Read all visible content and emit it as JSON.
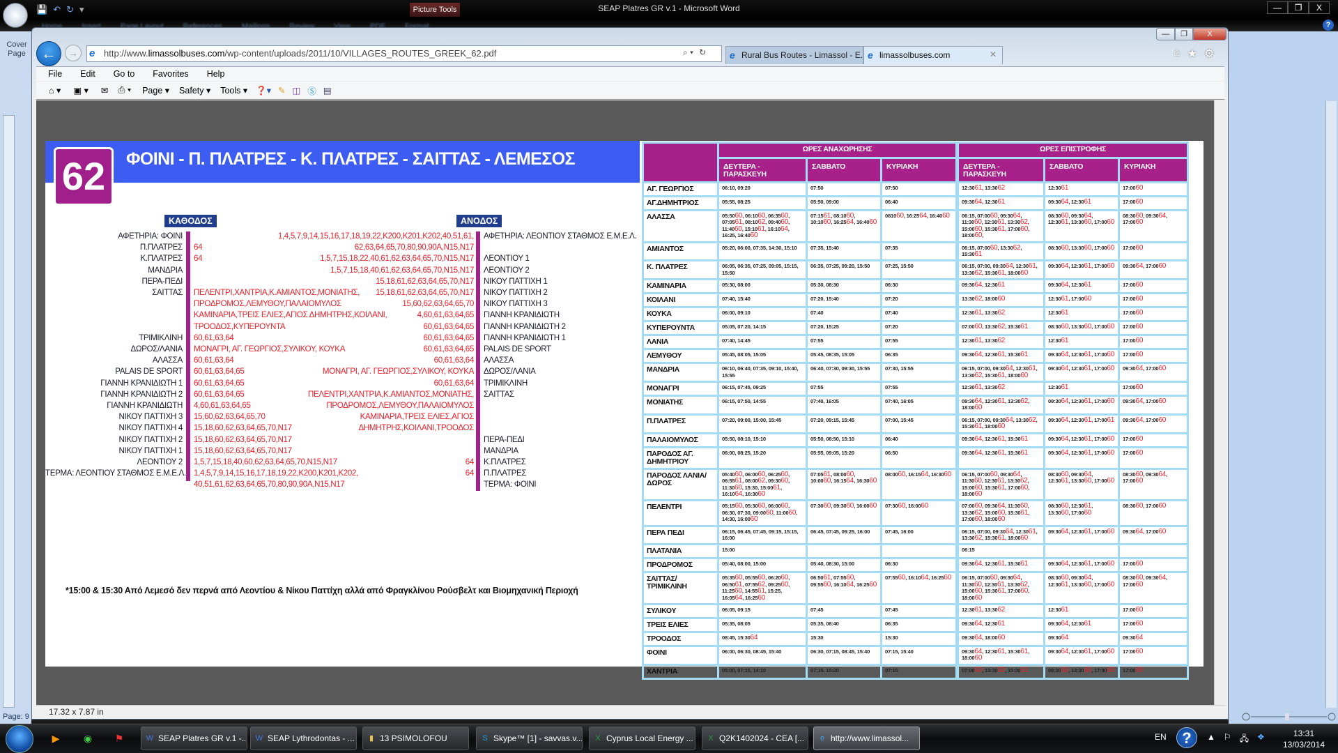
{
  "word": {
    "title": "SEAP Platres GR v.1 - Microsoft Word",
    "picture_tools": "Picture Tools",
    "tabs": [
      "Home",
      "Insert",
      "Page Layout",
      "References",
      "Mailings",
      "Review",
      "View",
      "PDF",
      "Format"
    ],
    "cover_page": "Cover Page",
    "page_status": "Page: 9",
    "controls": [
      "—",
      "❐",
      "X"
    ]
  },
  "ie": {
    "url_prefix": "http://www.",
    "url_domain": "limassolbuses.com",
    "url_path": "/wp-content/uploads/2011/10/VILLAGES_ROUTES_GREEK_62.pdf",
    "tabs": [
      {
        "label": "Rural Bus Routes - Limassol - E...",
        "active": false
      },
      {
        "label": "limassolbuses.com",
        "active": true
      }
    ],
    "menu": [
      "File",
      "Edit",
      "Go to",
      "Favorites",
      "Help"
    ],
    "command_bar": {
      "page": "Page ▾",
      "safety": "Safety ▾",
      "tools": "Tools ▾"
    },
    "status_text": "17.32 x 7.87 in",
    "controls": [
      "—",
      "❐",
      "X"
    ]
  },
  "pdf": {
    "route_number": "62",
    "route_title": "ΦΟΙΝΙ - Π. ΠΛΑΤΡΕΣ - Κ. ΠΛΑΤΡΕΣ - ΣΑΙΤΤΑΣ - ΛΕΜΕΣΟΣ",
    "kathodos_label": "ΚΑΘΟΔΟΣ",
    "anodos_label": "ΑΝΟΔΟΣ",
    "route_lines": [
      [
        "ΑΦΕΤΗΡΙΑ: ΦΟΙΝΙ",
        "",
        "1,4,5,7,9,14,15,16,17,18,19,22,K200,K201,K202,40,51,61,",
        "ΑΦΕΤΗΡΙΑ: ΛΕΟΝΤΙΟΥ ΣΤΑΘΜΟΣ Ε.Μ.Ε.Λ."
      ],
      [
        "Π.ΠΛΑΤΡΕΣ",
        "64",
        "62,63,64,65,70,80,90,90A,N15,N17",
        ""
      ],
      [
        "Κ.ΠΛΑΤΡΕΣ",
        "64",
        "1,5,7,15,18,22,40,61,62,63,64,65,70,N15,N17",
        "ΛΕΟΝΤΙΟΥ 1"
      ],
      [
        "ΜΑΝΔΡΙΑ",
        "",
        "1,5,7,15,18,40,61,62,63,64,65,70,N15,N17",
        "ΛΕΟΝΤΙΟΥ 2"
      ],
      [
        "ΠΕΡΑ-ΠΕΔΙ",
        "",
        "15,18,61,62,63,64,65,70,N17",
        "ΝΙΚΟΥ ΠΑΤΤΙΧΗ 1"
      ],
      [
        "ΣΑΙΤΤΑΣ",
        "ΠΕΛΕΝΤΡΙ,ΧΑΝΤΡΙΑ,Κ.ΑΜΙΑΝΤΟΣ,ΜΟΝΙΑΤΗΣ,",
        "15,18,61,62,63,64,65,70,N17",
        "ΝΙΚΟΥ ΠΑΤΤΙΧΗ 2"
      ],
      [
        "",
        "ΠΡΟΔΡΟΜΟΣ,ΛΕΜΥΘΟΥ,ΠΑΛΑΙΟΜΥΛΟΣ",
        "15,60,62,63,64,65,70",
        "ΝΙΚΟΥ ΠΑΤΤΙΧΗ 3"
      ],
      [
        "",
        "ΚΑΜΙΝΑΡΙΑ,ΤΡΕΙΣ ΕΛΙΕΣ,ΑΓΙΟΣ ΔΗΜΗΤΡΗΣ,ΚΟΙΛΑΝΙ,",
        "4,60,61,63,64,65",
        "ΓΙΑΝΝΗ ΚΡΑΝΙΔΙΩΤΗ"
      ],
      [
        "",
        "ΤΡΟΟΔΟΣ,ΚΥΠΕΡΟΥΝΤΑ",
        "60,61,63,64,65",
        "ΓΙΑΝΝΗ ΚΡΑΝΙΔΙΩΤΗ 2"
      ],
      [
        "ΤΡΙΜΙΚΛΙΝΗ",
        "60,61,63,64",
        "60,61,63,64,65",
        "ΓΙΑΝΝΗ ΚΡΑΝΙΔΙΩΤΗ 1"
      ],
      [
        "ΔΩΡΟΣ/ΛΑΝΙΑ",
        "ΜΟΝΑΓΡΙ, ΑΓ. ΓΕΩΡΓΙΟΣ,ΣΥΛΙΚΟΥ, ΚΟΥΚΑ",
        "60,61,63,64,65",
        "PALAIS DE SPORT"
      ],
      [
        "ΑΛΑΣΣΑ",
        "60,61,63,64",
        "60,61,63,64",
        "ΑΛΑΣΣΑ"
      ],
      [
        "PALAIS DE SPORT",
        "60,61,63,64,65",
        "ΜΟΝΑΓΡΙ, ΑΓ. ΓΕΩΡΓΙΟΣ,ΣΥΛΙΚΟΥ, ΚΟΥΚΑ",
        "ΔΩΡΟΣ/ΛΑΝΙΑ"
      ],
      [
        "ΓΙΑΝΝΗ ΚΡΑΝΙΔΙΩΤΗ 1",
        "60,61,63,64,65",
        "60,61,63,64",
        "ΤΡΙΜΙΚΛΙΝΗ"
      ],
      [
        "ΓΙΑΝΝΗ ΚΡΑΝΙΔΙΩΤΗ 2",
        "60,61,63,64,65",
        "ΠΕΛΕΝΤΡΙ,ΧΑΝΤΡΙΑ,Κ.ΑΜΙΑΝΤΟΣ,ΜΟΝΙΑΤΗΣ,",
        "ΣΑΙΤΤΑΣ"
      ],
      [
        "ΓΙΑΝΝΗ ΚΡΑΝΙΔΙΩΤΗ",
        "4,60,61,63,64,65",
        "ΠΡΟΔΡΟΜΟΣ,ΛΕΜΥΘΟΥ,ΠΑΛΑΙΟΜΥΛΟΣ",
        ""
      ],
      [
        "ΝΙΚΟΥ ΠΑΤΤΙΧΗ 3",
        "15,60,62,63,64,65,70",
        "ΚΑΜΙΝΑΡΙΑ,ΤΡΕΙΣ ΕΛΙΕΣ,ΑΓΙΟΣ",
        ""
      ],
      [
        "ΝΙΚΟΥ ΠΑΤΤΙΧΗ 4",
        "15,18,60,62,63,64,65,70,N17",
        "ΔΗΜΗΤΡΗΣ,ΚΟΙΛΑΝΙ,ΤΡΟΟΔΟΣ",
        ""
      ],
      [
        "ΝΙΚΟΥ ΠΑΤΤΙΧΗ 2",
        "15,18,60,62,63,64,65,70,N17",
        "",
        "ΠΕΡΑ-ΠΕΔΙ"
      ],
      [
        "ΝΙΚΟΥ ΠΑΤΤΙΧΗ 1",
        "15,18,60,62,63,64,65,70,N17",
        "",
        "ΜΑΝΔΡΙΑ"
      ],
      [
        "ΛΕΟΝΤΙΟΥ 2",
        "1,5,7,15,18,40,60,62,63,64,65,70,N15,N17",
        "64",
        "Κ.ΠΛΑΤΡΕΣ"
      ],
      [
        "ΤΕΡΜΑ: ΛΕΟΝΤΙΟΥ ΣΤΑΘΜΟΣ Ε.Μ.Ε.Λ.",
        "1,4,5,7,9,14,15,16,17,18,19,22,K200,K201,K202,",
        "64",
        "Π.ΠΛΑΤΡΕΣ"
      ],
      [
        "",
        "40,51,61,62,63,64,65,70,80,90,90A,N15,N17",
        "",
        "ΤΕΡΜΑ: ΦΟΙΝΙ"
      ]
    ],
    "footnote": "*15:00 & 15:30 Από Λεμεσό δεν περνά από Λεοντίου & Νίκου Παττίχη αλλά από Φραγκλίνου Ρούσβελτ και Βιομηχανική Περιοχή",
    "colors": {
      "title_band": "#3d5cf2",
      "purple": "#a8218a",
      "route_red": "#e8202a",
      "label_navy": "#203c8c",
      "grid_blue": "#a5dcf5"
    },
    "timetable": {
      "departures_header": "ΩΡΕΣ ΑΝΑΧΩΡΗΣΗΣ",
      "returns_header": "ΩΡΕΣ ΕΠΙΣΤΡΟΦΗΣ",
      "departure_days": [
        "ΔΕΥΤΕΡΑ - ΠΑΡΑΣΚΕΥΗ",
        "ΣΑΒΒΑΤΟ",
        "ΚΥΡΙΑΚΗ"
      ],
      "return_days": [
        "ΔΕΥΤΕΡΑ - ΠΑΡΑΣΚΕΥΗ",
        "ΣΑΒΒΑΤΟ",
        "ΚΥΡΙΑΚΗ"
      ],
      "rows": [
        {
          "stop": "ΑΓ. ΓΕΩΡΓΙΟΣ",
          "dep": [
            "06:10, 09:20",
            "07:50",
            "07:50"
          ],
          "ret": [
            "12:30[61], 13:30[62]",
            "12:30[61]",
            "17:00[60]"
          ]
        },
        {
          "stop": "ΑΓ.ΔΗΜΗΤΡΙΟΣ",
          "dep": [
            "05:55, 08:25",
            "05:50, 09:00",
            "06:40"
          ],
          "ret": [
            "09:30[64], 12:30[61]",
            "09:30[64], 12:30[61]",
            "17:00[60]"
          ]
        },
        {
          "stop": "ΑΛΑΣΣΑ",
          "dep": [
            "05:50[60], 06:10[60], 06:35[60], 07:05[61], 08:10[62], 09:40[60], 11:40[60], 15:10[61], 16:10[64], 16:25, 16:40[60]",
            "07:15[61], 08:10[60], 10:10[60], 16:25[64], 16:40[60]",
            "0810[60], 16:25[64], 16:40[60]"
          ],
          "ret": [
            "06:15, 07:00[60], 09:30[64], 11:30[60], 12:30[61], 13:30[62], 15:00[60], 15:30[61], 17:00[60], 18:00[60],",
            "08:30[60], 09:30[64], 12:30[61], 13:30[60], 17:00[60]",
            "08:30[60], 09:30[64], 17:00[60]"
          ]
        },
        {
          "stop": "ΑΜΙΑΝΤΟΣ",
          "dep": [
            "05:20, 06:00, 07:35, 14:30, 15:10",
            "07:35, 15:40",
            "07:35"
          ],
          "ret": [
            "06:15, 07:00[60], 13:30[62], 15:30[61]",
            "08:30[60], 13:30[60], 17:00[60]",
            "17:00[60]"
          ]
        },
        {
          "stop": "Κ. ΠΛΑΤΡΕΣ",
          "dep": [
            "06:05, 06:35, 07:25, 09:05, 15:15, 15:50",
            "06:35, 07:25, 09:20, 15:50",
            "07:25, 15:50"
          ],
          "ret": [
            "06:15, 07:00, 09:30[64], 12:30[61], 13:30[62], 15:30[61], 18:00[60]",
            "09:30[64], 12:30[61], 17:00[60]",
            "09:30[64], 17:00[60]"
          ]
        },
        {
          "stop": "ΚΑΜΙΝΑΡΙΑ",
          "dep": [
            "05:30, 08:00",
            "05:30, 08:30",
            "06:30"
          ],
          "ret": [
            "09:30[64], 12:30[61]",
            "09:30[64], 12:30[61]",
            "17:00[60]"
          ]
        },
        {
          "stop": "ΚΟΙΛΑΝΙ",
          "dep": [
            "07:40, 15:40",
            "07:20, 15:40",
            "07:20"
          ],
          "ret": [
            "13:30[62], 18:00[60]",
            "12:30[61], 17:00[60]",
            "17:00[60]"
          ]
        },
        {
          "stop": "ΚΟΥΚΑ",
          "dep": [
            "06:00, 09:10",
            "07:40",
            "07:40"
          ],
          "ret": [
            "12:30[61], 13:30[62]",
            "12:30[61]",
            "17:00[60]"
          ]
        },
        {
          "stop": "ΚΥΠΕΡΟΥΝΤΑ",
          "dep": [
            "05:05, 07:20, 14:15",
            "07:20, 15:25",
            "07:20"
          ],
          "ret": [
            "07:00[60], 13:30[62], 15:30[61]",
            "08:30[60], 13:30[60], 17:00[60]",
            "17:00[60]"
          ]
        },
        {
          "stop": "ΛΑΝΙΑ",
          "dep": [
            "07:40, 14:45",
            "07:55",
            "07:55"
          ],
          "ret": [
            "12:30[61], 13:30[62]",
            "12:30[61]",
            "17:00[60]"
          ]
        },
        {
          "stop": "ΛΕΜΥΘΟΥ",
          "dep": [
            "05:45, 08:05, 15:05",
            "05:45, 08:35, 15:05",
            "06:35"
          ],
          "ret": [
            "09:30[64], 12:30[61], 15:30[61]",
            "09:30[64], 12:30[61], 17:00[60]",
            "17:00[60]"
          ]
        },
        {
          "stop": "ΜΑΝΔΡΙΑ",
          "dep": [
            "06:10, 06:40, 07:35, 09:10, 15:40, 15:55",
            "06:40, 07:30, 09:30, 15:55",
            "07:30, 15:55"
          ],
          "ret": [
            "06:15, 07:00, 09:30[64], 12:30[61], 13:30[62], 15:30[61], 18:00[60]",
            "09:30[64], 12:30[61], 17:00[60]",
            "09:30[64], 17:00[60]"
          ]
        },
        {
          "stop": "ΜΟΝΑΓΡΙ",
          "dep": [
            "06:15, 07:45, 09:25",
            "07:55",
            "07:55"
          ],
          "ret": [
            "12:30[61], 13:30[62]",
            "12:30[61]",
            "17:00[60]"
          ]
        },
        {
          "stop": "ΜΟΝΙΑΤΗΣ",
          "dep": [
            "06:15, 07:50, 14:55",
            "07:40, 16:05",
            "07:40, 16:05"
          ],
          "ret": [
            "09:30[64], 12:30[61], 13:30[62], 18:00[60]",
            "09:30[64], 12:30[61], 17:00[60]",
            "09:30[64], 17:00[60]"
          ]
        },
        {
          "stop": "Π.ΠΛΑΤΡΕΣ",
          "dep": [
            "07:20, 09:00, 15:00, 15:45",
            "07:20, 09:15, 15:45",
            "07:00, 15:45"
          ],
          "ret": [
            "06:15, 07:00, 09:30[64], 13:30[62], 15:30[61], 18:00[60]",
            "09:30[64], 12:30[61], 17:00[61]",
            "09:30[64], 17:00[60]"
          ]
        },
        {
          "stop": "ΠΑΛΑΙΟΜΥΛΟΣ",
          "dep": [
            "05:50, 08:10, 15:10",
            "05:50, 08:50, 15:10",
            "06:40"
          ],
          "ret": [
            "09:30[64], 12:30[61], 15:30[61]",
            "09:30[64], 12:30[61], 17:00[60]",
            "17:00[60]"
          ]
        },
        {
          "stop": "ΠΑΡΟΔΟΣ ΑΓ. ΔΗΜΗΤΡΙΟΥ",
          "dep": [
            "06:00, 08:25, 15:20",
            "05:55, 09:05, 15:20",
            "06:50"
          ],
          "ret": [
            "09:30[64], 12:30[61], 15:30[61]",
            "09:30[64], 12:30[61], 17:00[60]",
            "17:00[60]"
          ]
        },
        {
          "stop": "ΠΑΡΟΔΟΣ ΛΑΝΙΑ/ ΔΩΡΟΣ",
          "dep": [
            "05:40[60], 06:00[60], 06:25[60], 06:55[61], 08:00[62], 09:30[60], 11:30[60], 15:30, 15:00[61], 16:10[64], 16:30[60]",
            "07:05[61], 08:00[60], 10:00[60], 16:15[64], 16:30[60]",
            "08:00[60], 16:15[64], 16:30[60]"
          ],
          "ret": [
            "06:15, 07:00[60], 09:30[64], 11:30[60], 12:30[61], 13:30[62], 15:00[60], 15:30[61], 17:00[60], 18:00[60]",
            "08:30[60], 09:30[64], 12:30[61], 13:30[60], 17:00[60]",
            "08:30[60], 09:30[64], 17:00[60]"
          ]
        },
        {
          "stop": "ΠΕΛΕΝΤΡΙ",
          "dep": [
            "05:15[60], 05:30[60], 06:00[60], 06:30, 07:30, 09:00[60], 11:00[60], 14:30, 16:00[60]",
            "07:30[60], 09:30[60], 16:00[60]",
            "07:30[60], 16:00[60]"
          ],
          "ret": [
            "07:00[60], 09:30[64], 11:30[60], 13:30[62], 15:00[60], 15:30[61], 17:00[60], 18:00[60]",
            "08:30[60], 12:30[61], 13:30[60], 17:00[60]",
            "08:30[60], 17:00[60]"
          ]
        },
        {
          "stop": "ΠΕΡΑ ΠΕΔΙ",
          "dep": [
            "06:15, 06:45, 07:45, 09:15, 15:15, 16:00",
            "06:45, 07:45, 09:25, 16:00",
            "07:45, 16:00"
          ],
          "ret": [
            "06:15, 07:00, 09:30[64], 12:30[61], 13:30[62], 15:30[61], 18:00[60]",
            "09:30[64], 12:30[61], 17:00[60]",
            "09:30[64], 17:00[60]"
          ]
        },
        {
          "stop": "ΠΛΑΤΑΝΙΑ",
          "dep": [
            "15:00",
            "",
            ""
          ],
          "ret": [
            "06:15",
            "",
            ""
          ]
        },
        {
          "stop": "ΠΡΟΔΡΟΜΟΣ",
          "dep": [
            "05:40, 08:00, 15:00",
            "05:40, 08:30, 15:00",
            "06:30"
          ],
          "ret": [
            "09:30[64], 12:30[61], 15:30[61]",
            "09:30[64], 12:30[61], 17:00[60]",
            "17:00[60]"
          ]
        },
        {
          "stop": "ΣΑΙΤΤΑΣ/ ΤΡΙΜΙΚΛΙΝΗ",
          "dep": [
            "05:35[60], 05:55[60], 06:20[60], 06:50[61], 07:55[62], 09:25[60], 11:25[60], 14:55[61], 15:25, 16:05[64], 16:25[60]",
            "06:50[61], 07:55[60], 09:55[60], 16:10[64], 16:25[60]",
            "07:55[60], 16:10[64], 16:25[60]"
          ],
          "ret": [
            "06:15, 07:00[60], 09:30[64], 11:30[60], 12:30[61], 13:30[62], 15:00[60], 15:30[61], 17:00[60], 18:00[60]",
            "08:30[60], 09:30[64], 12:30[61], 13:30[60], 17:00[60]",
            "08:30[60], 09:30[64], 17:00[60]"
          ]
        },
        {
          "stop": "ΣΥΛΙΚΟΥ",
          "dep": [
            "06:05, 09:15",
            "07:45",
            "07:45"
          ],
          "ret": [
            "12:30[61], 13:30[62]",
            "12:30[61]",
            "17:00[60]"
          ]
        },
        {
          "stop": "ΤΡΕΙΣ ΕΛΙΕΣ",
          "dep": [
            "05:35, 08:05",
            "05:35, 08:40",
            "06:35"
          ],
          "ret": [
            "09:30[64], 12:30[61]",
            "09:30[64], 12:30[61]",
            "17:00[60]"
          ]
        },
        {
          "stop": "ΤΡΟΟΔΟΣ",
          "dep": [
            "08:45, 15:30[64]",
            "15:30",
            "15:30"
          ],
          "ret": [
            "09:30[64], 18:00[60]",
            "09:30[64]",
            "09:30[64]"
          ]
        },
        {
          "stop": "ΦΟΙΝΙ",
          "dep": [
            "06:00, 06:30, 08:45, 15:40",
            "06:30, 07:15, 08:45, 15:40",
            "07:15, 15:40"
          ],
          "ret": [
            "09:30[64], 12:30[61], 15:30[61], 18:00[60]",
            "09:30[64], 12:30[61], 17:00[60]",
            "17:00[60]"
          ]
        },
        {
          "stop": "ΧΑΝΤΡΙΑ",
          "dep": [
            "05:00, 07:15, 14:10",
            "07:15, 15:20",
            "07:15"
          ],
          "ret": [
            "07:00[60], 13:30[62], 15:30[61]",
            "08:30[60], 13:30[60], 17:00[60]",
            "17:00[60]"
          ]
        }
      ]
    }
  },
  "taskbar": {
    "quick_launch": [
      "media-player-icon",
      "chrome-icon",
      "acrobat-icon"
    ],
    "items": [
      {
        "label": "SEAP Platres GR v.1 -...",
        "icon": "word-icon",
        "active": false
      },
      {
        "label": "SEAP Lythrodontas - ...",
        "icon": "word-icon",
        "active": false
      },
      {
        "label": "13 PSIMOLOFOU",
        "icon": "folder-icon",
        "active": false
      },
      {
        "label": "Skype™ [1] - savvas.v...",
        "icon": "skype-icon",
        "active": false
      },
      {
        "label": "Cyprus Local Energy ...",
        "icon": "excel-icon",
        "active": false
      },
      {
        "label": "Q2K1402024 - CEA  [...",
        "icon": "excel-icon",
        "active": false
      },
      {
        "label": "http://www.limassol...",
        "icon": "ie-icon",
        "active": true
      }
    ],
    "language": "EN",
    "time": "13:31",
    "date": "13/03/2014"
  }
}
